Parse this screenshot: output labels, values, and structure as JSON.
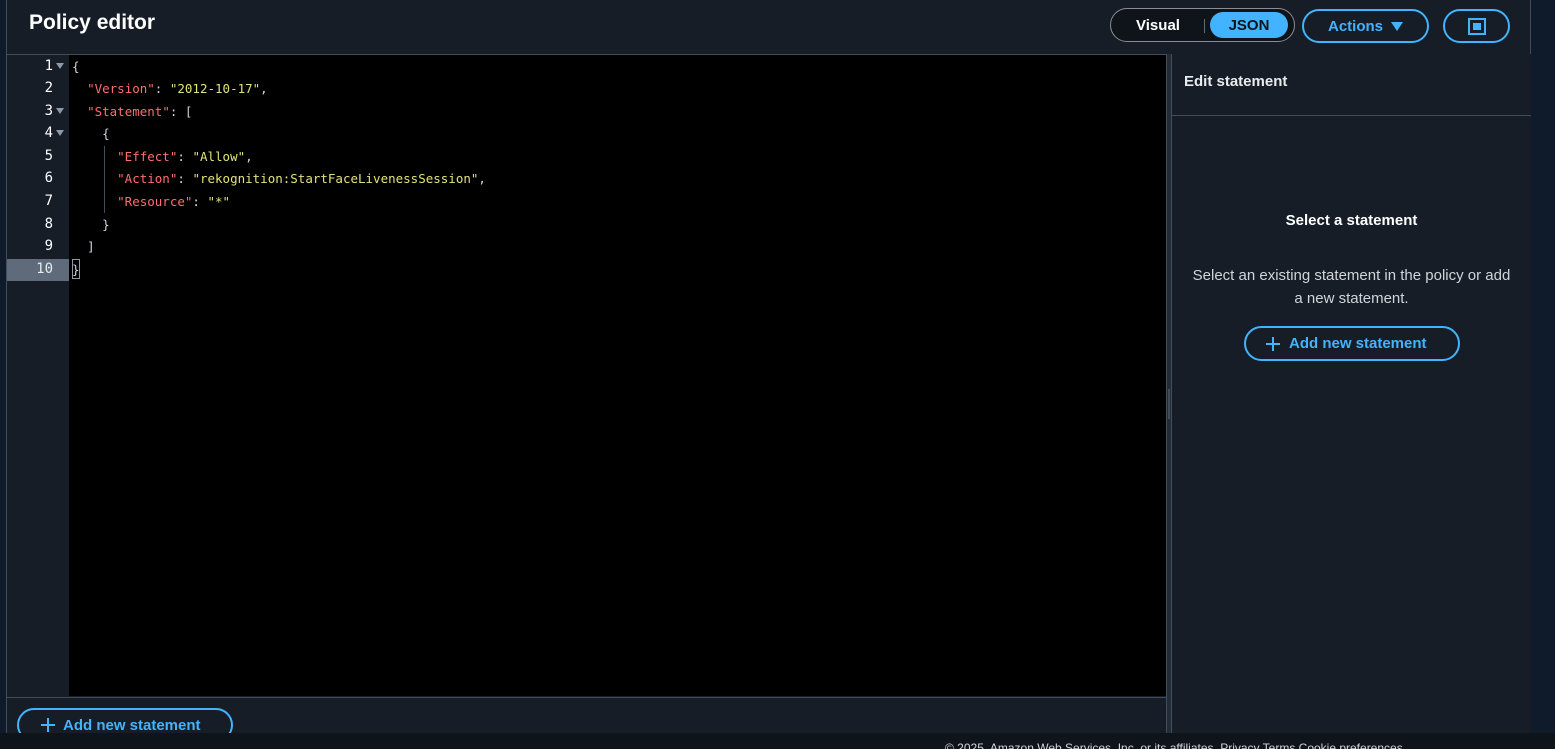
{
  "header": {
    "title": "Policy editor",
    "mode_visual": "Visual",
    "mode_json": "JSON",
    "actions_label": "Actions",
    "fullscreen_icon": "fullscreen-icon"
  },
  "editor": {
    "active_line": 10,
    "lines": [
      {
        "num": "1",
        "fold": true
      },
      {
        "num": "2",
        "fold": false
      },
      {
        "num": "3",
        "fold": true
      },
      {
        "num": "4",
        "fold": true
      },
      {
        "num": "5",
        "fold": false
      },
      {
        "num": "6",
        "fold": false
      },
      {
        "num": "7",
        "fold": false
      },
      {
        "num": "8",
        "fold": false
      },
      {
        "num": "9",
        "fold": false
      },
      {
        "num": "10",
        "fold": false
      }
    ],
    "code": {
      "l1": "{",
      "version_key": "\"Version\"",
      "version_val": "\"2012-10-17\"",
      "statement_key": "\"Statement\"",
      "l3_rest": ": [",
      "l4": "{",
      "effect_key": "\"Effect\"",
      "effect_val": "\"Allow\"",
      "action_key": "\"Action\"",
      "action_val": "\"rekognition:StartFaceLivenessSession\"",
      "resource_key": "\"Resource\"",
      "resource_val": "\"*\"",
      "l8": "}",
      "l9": "]",
      "l10": "}"
    }
  },
  "bottom": {
    "add_label": "Add new statement"
  },
  "side": {
    "title": "Edit statement",
    "empty_title": "Select a statement",
    "empty_desc": "Select an existing statement in the policy or add a new statement.",
    "add_label": "Add new statement"
  },
  "footer": {
    "text": "© 2025, Amazon Web Services, Inc. or its affiliates.     Privacy     Terms     Cookie preferences"
  },
  "colors": {
    "accent": "#42b4ff",
    "json_key": "#ff6d6d",
    "json_string": "#e2e27a"
  }
}
